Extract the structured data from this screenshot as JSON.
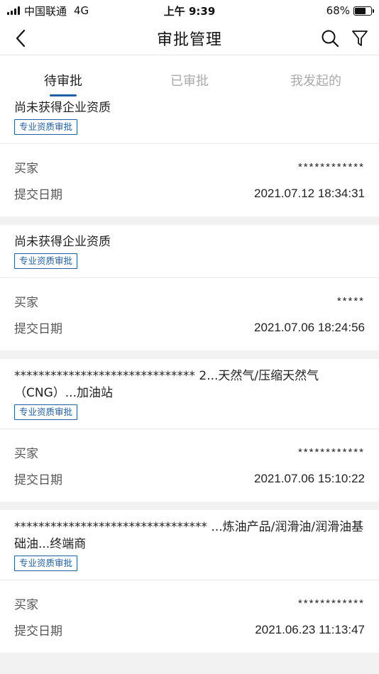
{
  "status_bar": {
    "carrier": "中国联通",
    "network": "4G",
    "time": "上午 9:39",
    "battery_text": "68%",
    "battery_level": 0.68
  },
  "nav": {
    "title": "审批管理",
    "back_icon": "chevron-left-icon",
    "search_icon": "search-icon",
    "filter_icon": "filter-icon"
  },
  "tabs": [
    {
      "label": "待审批",
      "active": true
    },
    {
      "label": "已审批",
      "active": false
    },
    {
      "label": "我发起的",
      "active": false
    }
  ],
  "accent_color": "#1f5fa8",
  "cards": [
    {
      "title": "尚未获得企业资质",
      "tag": "专业资质审批",
      "buyer_label": "买家",
      "buyer_value": "************",
      "date_label": "提交日期",
      "date_value": "2021.07.12 18:34:31"
    },
    {
      "title": "尚未获得企业资质",
      "tag": "专业资质审批",
      "buyer_label": "买家",
      "buyer_value": "*****",
      "date_label": "提交日期",
      "date_value": "2021.07.06 18:24:56"
    },
    {
      "title": "****************************** 2...天然气/压缩天然气（CNG）...加油站",
      "tag": "专业资质审批",
      "buyer_label": "买家",
      "buyer_value": "************",
      "date_label": "提交日期",
      "date_value": "2021.07.06 15:10:22"
    },
    {
      "title": "******************************** ...炼油产品/润滑油/润滑油基础油...终端商",
      "tag": "专业资质审批",
      "buyer_label": "买家",
      "buyer_value": "************",
      "date_label": "提交日期",
      "date_value": "2021.06.23 11:13:47"
    }
  ]
}
